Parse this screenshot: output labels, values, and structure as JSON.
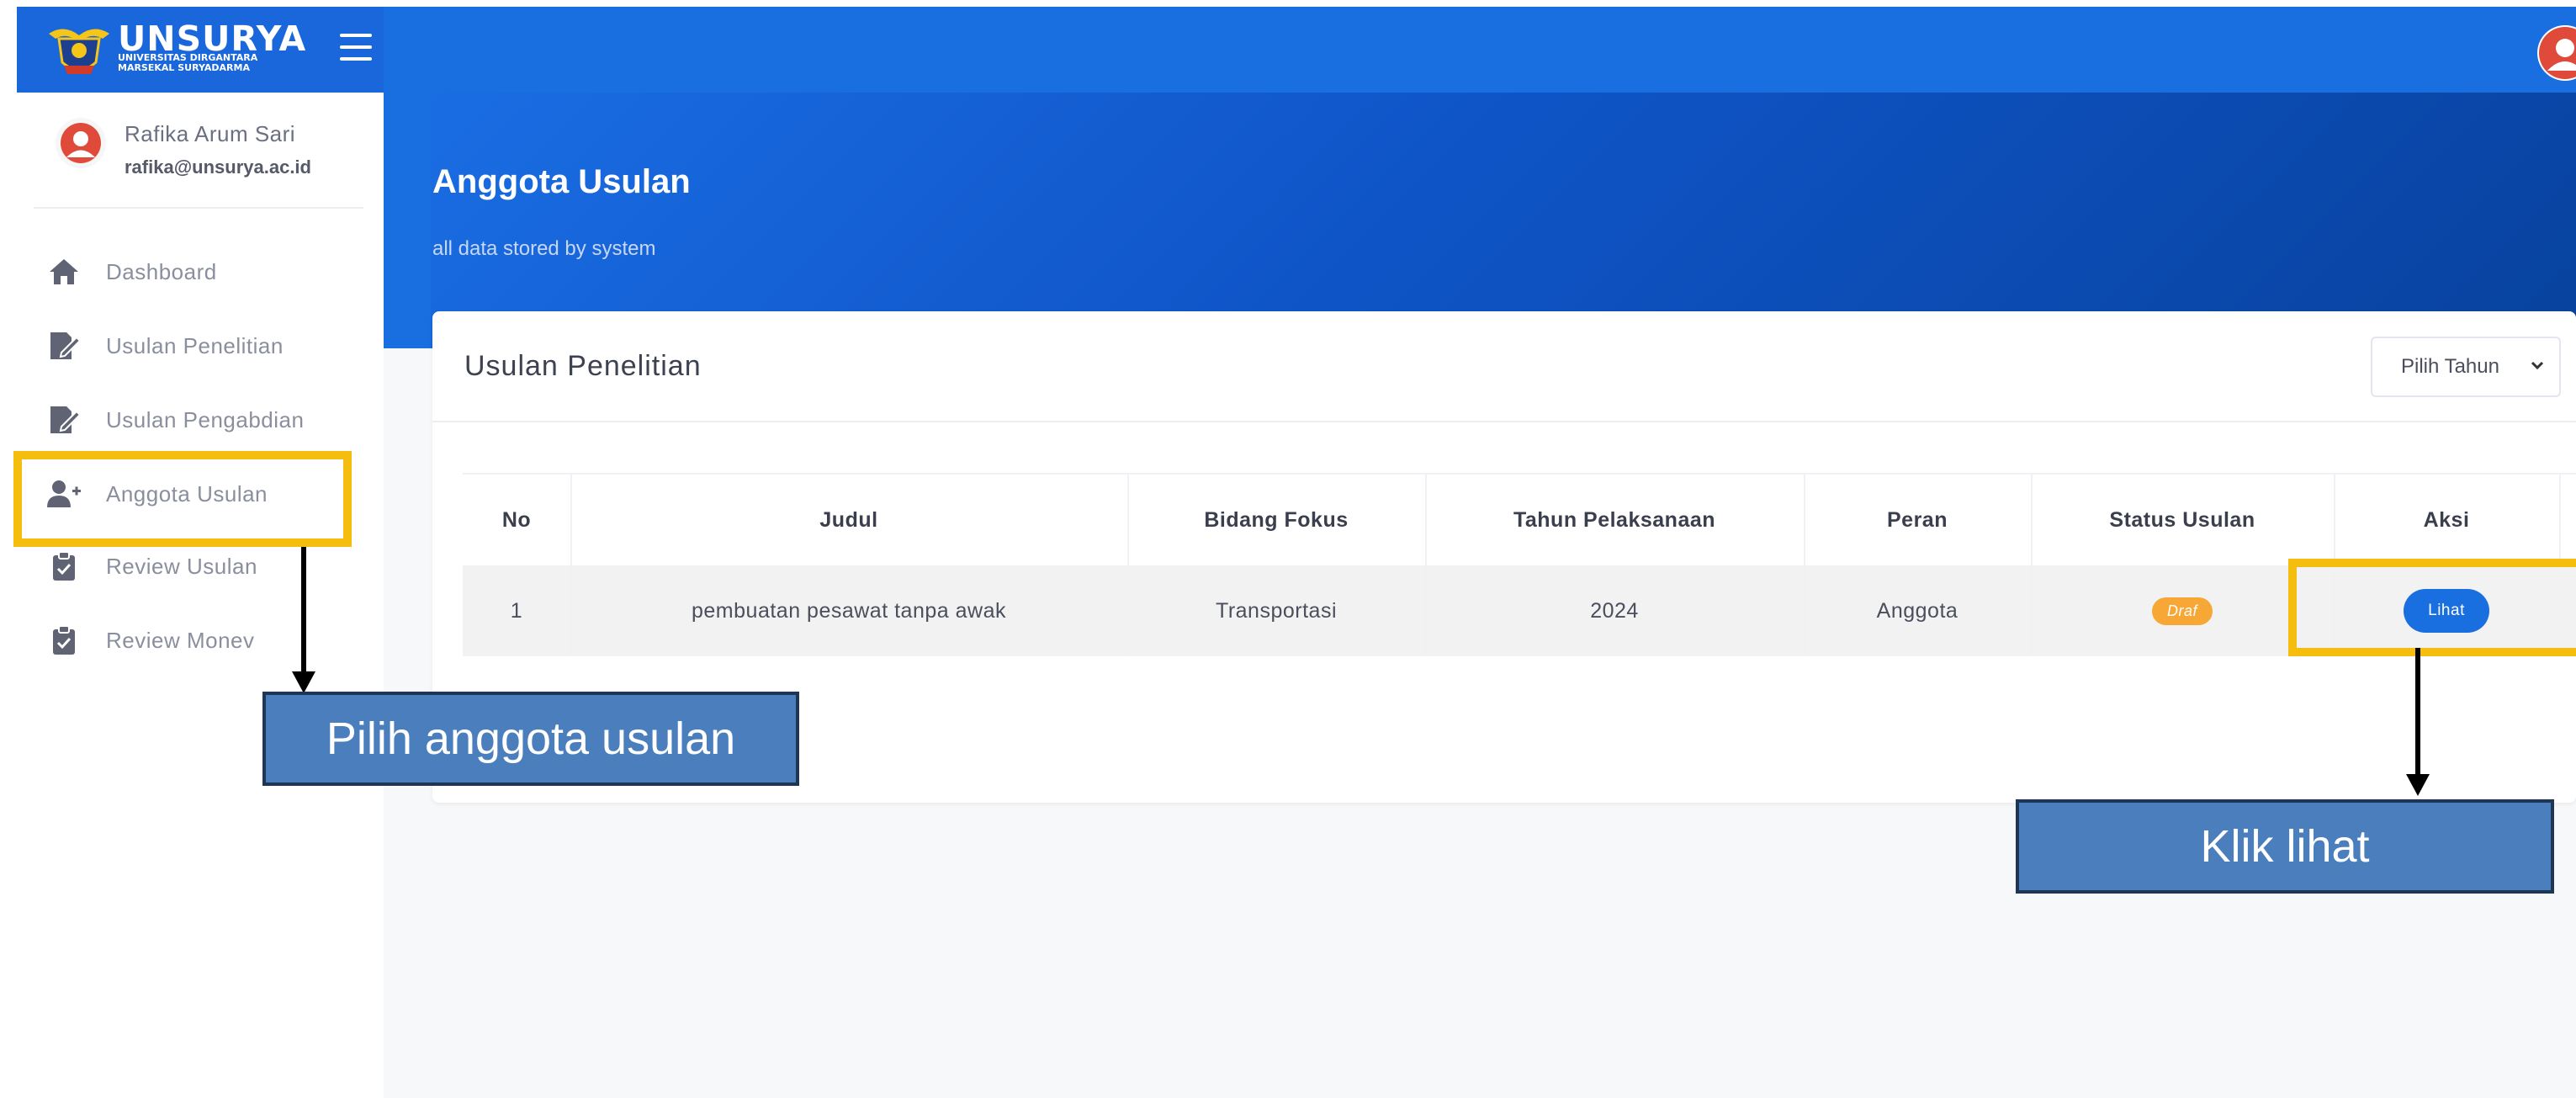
{
  "brand": {
    "name": "UNSURYA",
    "sub_line1": "UNIVERSITAS DIRGANTARA",
    "sub_line2": "MARSEKAL SURYADARMA"
  },
  "user": {
    "name": "Rafika Arum Sari",
    "email": "rafika@unsurya.ac.id"
  },
  "sidebar": {
    "items": [
      {
        "label": "Dashboard",
        "icon": "home-icon"
      },
      {
        "label": "Usulan Penelitian",
        "icon": "edit-document-icon"
      },
      {
        "label": "Usulan Pengabdian",
        "icon": "edit-document-icon"
      },
      {
        "label": "Anggota Usulan",
        "icon": "user-plus-icon"
      },
      {
        "label": "Review Usulan",
        "icon": "clipboard-check-icon"
      },
      {
        "label": "Review Monev",
        "icon": "clipboard-check-icon"
      }
    ]
  },
  "page": {
    "title": "Anggota Usulan",
    "subtitle": "all data stored by system"
  },
  "card": {
    "title": "Usulan Penelitian",
    "year_select": "Pilih Tahun"
  },
  "table": {
    "headers": [
      "No",
      "Judul",
      "Bidang Fokus",
      "Tahun Pelaksanaan",
      "Peran",
      "Status Usulan",
      "Aksi"
    ],
    "rows": [
      {
        "no": "1",
        "judul": "pembuatan pesawat tanpa awak",
        "bidang_fokus": "Transportasi",
        "tahun": "2024",
        "peran": "Anggota",
        "status": "Draf",
        "aksi": "Lihat"
      }
    ]
  },
  "annotations": {
    "callout_menu": "Pilih anggota usulan",
    "callout_button": "Klik lihat"
  },
  "colors": {
    "primary": "#1a6fe0",
    "highlight": "#f5bd0d",
    "badge_draft": "#f6a735",
    "callout": "#4a7ebd"
  }
}
